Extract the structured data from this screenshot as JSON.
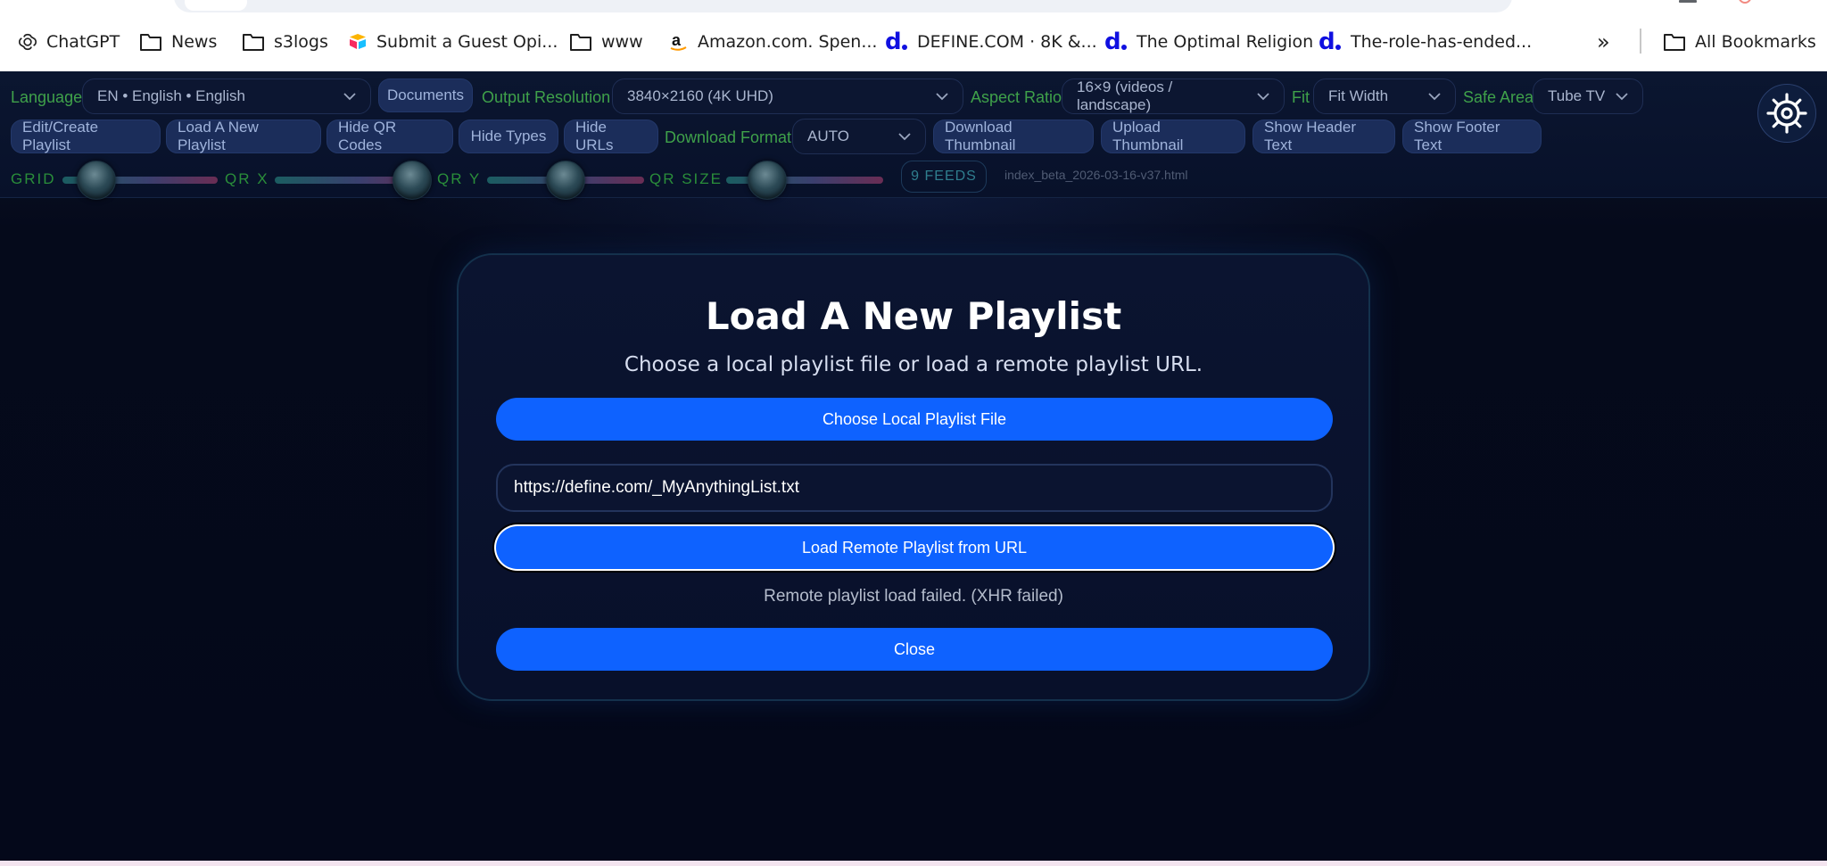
{
  "browser": {
    "bookmarks": [
      {
        "label": "ChatGPT",
        "icon": "chatgpt-icon"
      },
      {
        "label": "News",
        "icon": "folder-icon"
      },
      {
        "label": "s3logs",
        "icon": "folder-icon"
      },
      {
        "label": "Submit a Guest Opi...",
        "icon": "airtable-icon"
      },
      {
        "label": "www",
        "icon": "folder-icon"
      },
      {
        "label": "Amazon.com. Spen...",
        "icon": "amazon-icon"
      },
      {
        "label": "DEFINE.COM · 8K &...",
        "icon": "define-icon"
      },
      {
        "label": "The Optimal Religion",
        "icon": "define-icon"
      },
      {
        "label": "The-role-has-ended...",
        "icon": "define-icon"
      }
    ],
    "more_label": "»",
    "all_bookmarks": "All Bookmarks"
  },
  "toolbar": {
    "language": {
      "label": "Language",
      "value": "EN • English • English"
    },
    "documents_button": "Documents",
    "output_resolution": {
      "label": "Output Resolution",
      "value": "3840×2160 (4K UHD)"
    },
    "aspect_ratio": {
      "label": "Aspect Ratio",
      "value": "16×9 (videos / landscape)"
    },
    "fit": {
      "label": "Fit",
      "value": "Fit Width"
    },
    "safe_area": {
      "label": "Safe Area",
      "value": "Tube TV"
    },
    "row2_buttons": [
      "Edit/Create Playlist",
      "Load A New Playlist",
      "Hide QR Codes",
      "Hide Types",
      "Hide URLs"
    ],
    "download_format": {
      "label": "Download Format",
      "value": "AUTO"
    },
    "row2_buttons_right": [
      "Download Thumbnail",
      "Upload Thumbnail",
      "Show Header Text",
      "Show Footer Text"
    ],
    "sliders": [
      {
        "label": "GRID"
      },
      {
        "label": "QR X"
      },
      {
        "label": "QR Y"
      },
      {
        "label": "QR SIZE"
      }
    ],
    "feeds_badge": "9 FEEDS",
    "version": "index_beta_2026-03-16-v37.html"
  },
  "modal": {
    "title": "Load A New Playlist",
    "subtitle": "Choose a local playlist file or load a remote playlist URL.",
    "choose_local_button": "Choose Local Playlist File",
    "url_input_value": "https://define.com/_MyAnythingList.txt",
    "load_remote_button": "Load Remote Playlist from URL",
    "status": "Remote playlist load failed. (XHR failed)",
    "close_button": "Close"
  },
  "colors": {
    "accent_blue": "#0e62ff",
    "label_green": "#3fa14a",
    "background": "#05091a"
  }
}
